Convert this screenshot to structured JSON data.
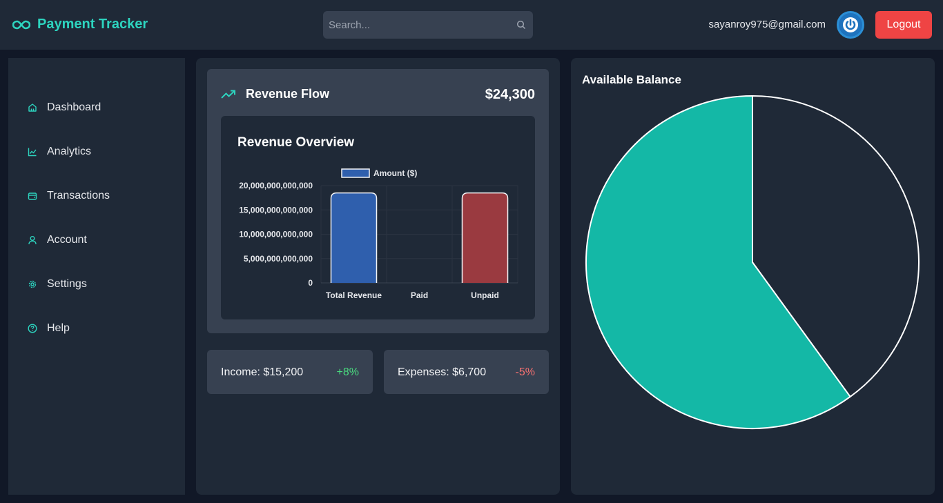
{
  "header": {
    "brand": "Payment Tracker",
    "search_placeholder": "Search...",
    "email": "sayanroy975@gmail.com",
    "logout_label": "Logout"
  },
  "sidebar": {
    "items": [
      {
        "label": "Dashboard",
        "icon": "home-icon"
      },
      {
        "label": "Analytics",
        "icon": "line-chart-icon"
      },
      {
        "label": "Transactions",
        "icon": "wallet-icon"
      },
      {
        "label": "Account",
        "icon": "user-icon"
      },
      {
        "label": "Settings",
        "icon": "gear-icon"
      },
      {
        "label": "Help",
        "icon": "help-circle-icon"
      }
    ]
  },
  "revenue": {
    "title": "Revenue Flow",
    "amount": "$24,300",
    "chart_title": "Revenue Overview"
  },
  "stats": {
    "income_label": "Income: $15,200",
    "income_change": "+8%",
    "expenses_label": "Expenses: $6,700",
    "expenses_change": "-5%"
  },
  "balance": {
    "title": "Available Balance"
  },
  "colors": {
    "accent": "#2dd4bf",
    "bar_total": "#2f5fad",
    "bar_unpaid": "#9a3a40",
    "pie_teal": "#14b8a6",
    "positive": "#4ade80",
    "negative": "#f87171",
    "logout": "#ef4444"
  },
  "chart_data": [
    {
      "type": "bar",
      "title": "Revenue Overview",
      "categories": [
        "Total Revenue",
        "Paid",
        "Unpaid"
      ],
      "series": [
        {
          "name": "Amount ($)",
          "values": [
            18500000000000,
            0,
            18500000000000
          ]
        }
      ],
      "ylim": [
        0,
        20000000000000
      ],
      "yticks": [
        "0",
        "5,000,000,000,000",
        "10,000,000,000,000",
        "15,000,000,000,000",
        "20,000,000,000,000"
      ],
      "ytick_values": [
        0,
        5000000000000,
        10000000000000,
        15000000000000,
        20000000000000
      ],
      "legend": "top",
      "grid": true
    },
    {
      "type": "pie",
      "title": "Available Balance",
      "slices": [
        {
          "value": 60,
          "color": "#14b8a6"
        },
        {
          "value": 40,
          "color": "#1f2937"
        }
      ]
    }
  ]
}
